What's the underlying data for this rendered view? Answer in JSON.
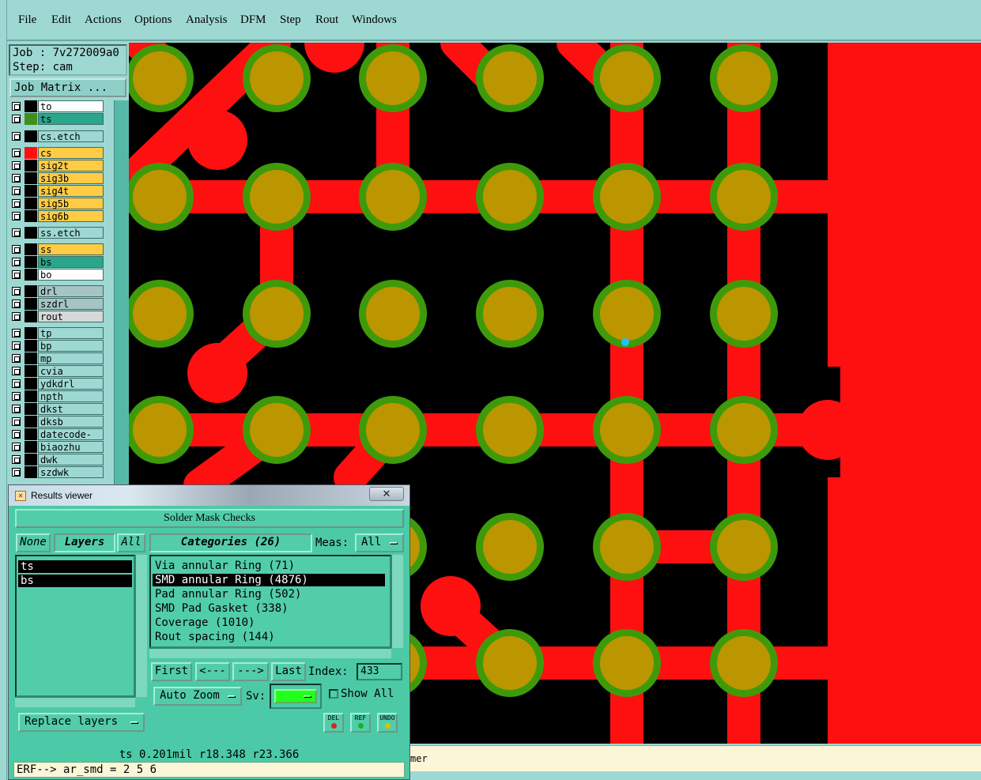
{
  "menu": [
    "File",
    "Edit",
    "Actions",
    "Options",
    "Analysis",
    "DFM",
    "Step",
    "Rout",
    "Windows"
  ],
  "job": {
    "job_line": "Job : 7v272009a0",
    "step_line": "Step: cam",
    "matrix_button": "Job Matrix ..."
  },
  "layers": [
    {
      "name": "to",
      "color": "#000000",
      "bg": "#ffffff"
    },
    {
      "name": "ts",
      "color": "#3f8f1a",
      "bg": "#2aa68a"
    },
    {
      "name": "cs.etch",
      "color": "#000000",
      "bg": "#9ed8d2"
    },
    {
      "name": "cs",
      "color": "#ff1010",
      "bg": "#ffcc44"
    },
    {
      "name": "sig2t",
      "color": "#000000",
      "bg": "#ffcc44"
    },
    {
      "name": "sig3b",
      "color": "#000000",
      "bg": "#ffcc44"
    },
    {
      "name": "sig4t",
      "color": "#000000",
      "bg": "#ffcc44"
    },
    {
      "name": "sig5b",
      "color": "#000000",
      "bg": "#ffcc44"
    },
    {
      "name": "sig6b",
      "color": "#000000",
      "bg": "#ffcc44"
    },
    {
      "name": "ss.etch",
      "color": "#000000",
      "bg": "#9ed8d2"
    },
    {
      "name": "ss",
      "color": "#000000",
      "bg": "#ffcc44"
    },
    {
      "name": "bs",
      "color": "#000000",
      "bg": "#2aa68a"
    },
    {
      "name": "bo",
      "color": "#000000",
      "bg": "#ffffff"
    },
    {
      "name": "drl",
      "color": "#000000",
      "bg": "#a7c4c4"
    },
    {
      "name": "szdrl",
      "color": "#000000",
      "bg": "#a7c4c4"
    },
    {
      "name": "rout",
      "color": "#000000",
      "bg": "#d8d8d8"
    },
    {
      "name": "tp",
      "color": "#000000",
      "bg": "#9ed8d2"
    },
    {
      "name": "bp",
      "color": "#000000",
      "bg": "#9ed8d2"
    },
    {
      "name": "mp",
      "color": "#000000",
      "bg": "#9ed8d2"
    },
    {
      "name": "cvia",
      "color": "#000000",
      "bg": "#9ed8d2"
    },
    {
      "name": "ydkdrl",
      "color": "#000000",
      "bg": "#9ed8d2"
    },
    {
      "name": "npth",
      "color": "#000000",
      "bg": "#9ed8d2"
    },
    {
      "name": "dkst",
      "color": "#000000",
      "bg": "#9ed8d2"
    },
    {
      "name": "dksb",
      "color": "#000000",
      "bg": "#9ed8d2"
    },
    {
      "name": "datecode-to",
      "color": "#000000",
      "bg": "#9ed8d2"
    },
    {
      "name": "biaozhu",
      "color": "#000000",
      "bg": "#9ed8d2"
    },
    {
      "name": "dwk",
      "color": "#000000",
      "bg": "#9ed8d2"
    },
    {
      "name": "szdwk",
      "color": "#000000",
      "bg": "#9ed8d2"
    }
  ],
  "results_viewer": {
    "title": "Results viewer",
    "close": "✕",
    "header": "Solder Mask Checks",
    "none_btn": "None",
    "layers_btn": "Layers",
    "all_btn": "All",
    "layer_items": [
      "ts",
      "bs"
    ],
    "categories_btn": "Categories (26)",
    "meas_label": "Meas:",
    "meas_value": "All",
    "categories": [
      {
        "label": "Via annular Ring (71)",
        "selected": false
      },
      {
        "label": "SMD annular Ring (4876)",
        "selected": true
      },
      {
        "label": "Pad annular Ring (502)",
        "selected": false
      },
      {
        "label": "SMD Pad Gasket (338)",
        "selected": false
      },
      {
        "label": "Coverage (1010)",
        "selected": false
      },
      {
        "label": "Rout spacing (144)",
        "selected": false
      }
    ],
    "first_btn": "First",
    "prev_btn": "<---",
    "next_btn": "--->",
    "last_btn": "Last",
    "index_label": "Index:",
    "index_value": "433",
    "zoom_value": "Auto Zoom",
    "sv_label": "Sv:",
    "show_all_label": "Show All",
    "replace_layers": "Replace layers",
    "del_label": "DEL",
    "ref_label": "REF",
    "undo_label": "UNDO",
    "status": "ts 0.201mil  r18.348  r23.366",
    "command": "ERF--> ar_smd = 2 5 6"
  },
  "statusline_text": "mer",
  "colors": {
    "copper": "#ff1010",
    "pad": "#bb9600",
    "mask": "#3f9a0a",
    "background": "#000000"
  }
}
